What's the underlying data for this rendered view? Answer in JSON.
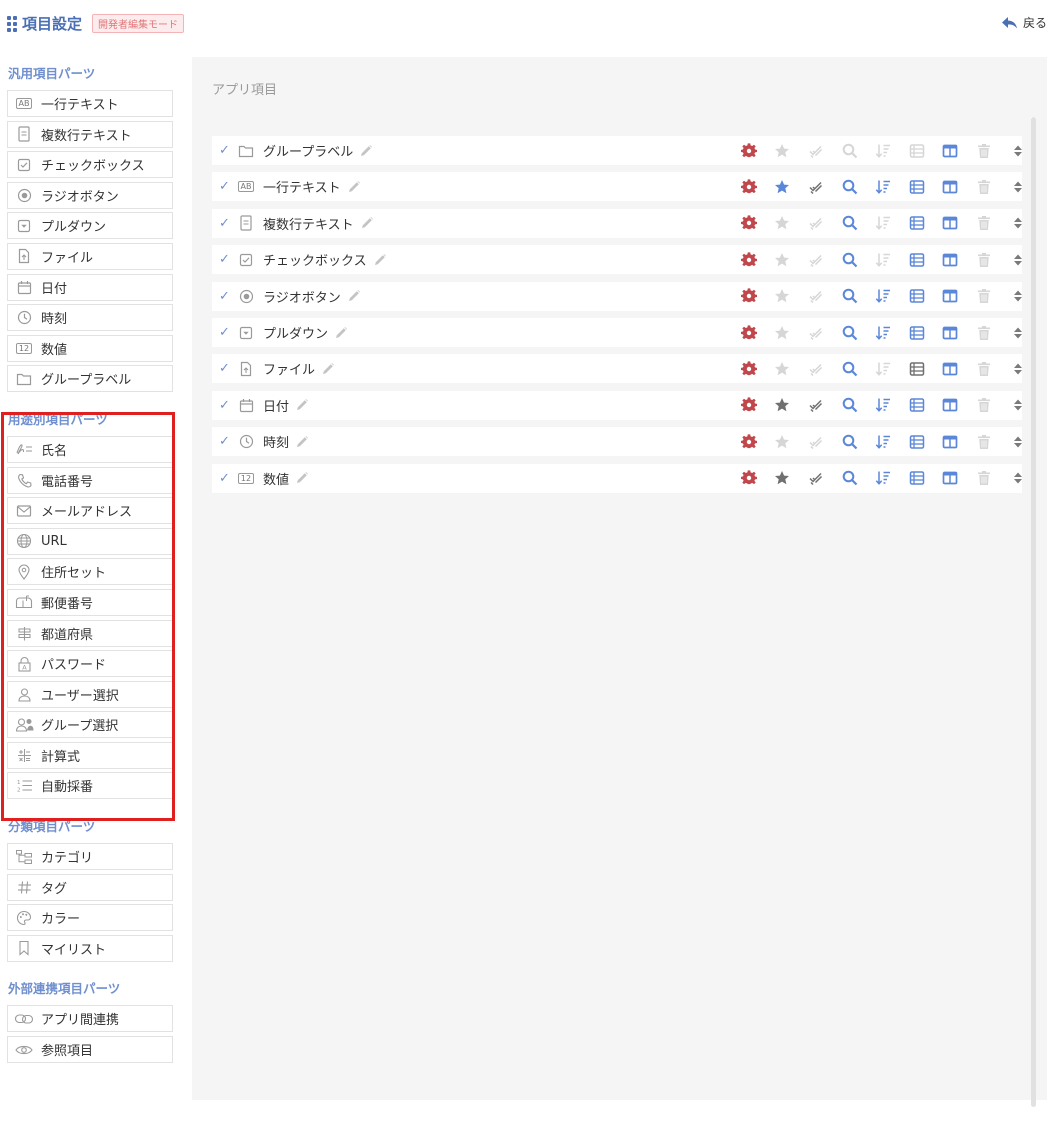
{
  "header": {
    "title": "項目設定",
    "mode_badge": "開発者編集モード",
    "back_label": "戻る"
  },
  "sidebar": {
    "sections": [
      {
        "title": "汎用項目パーツ",
        "items": [
          {
            "label": "一行テキスト",
            "icon": "ab-text-icon"
          },
          {
            "label": "複数行テキスト",
            "icon": "document-icon"
          },
          {
            "label": "チェックボックス",
            "icon": "checkbox-icon"
          },
          {
            "label": "ラジオボタン",
            "icon": "radio-icon"
          },
          {
            "label": "プルダウン",
            "icon": "dropdown-icon"
          },
          {
            "label": "ファイル",
            "icon": "file-upload-icon"
          },
          {
            "label": "日付",
            "icon": "calendar-icon"
          },
          {
            "label": "時刻",
            "icon": "clock-icon"
          },
          {
            "label": "数値",
            "icon": "number-icon"
          },
          {
            "label": "グループラベル",
            "icon": "folder-icon"
          }
        ]
      },
      {
        "title": "用途別項目パーツ",
        "items": [
          {
            "label": "氏名",
            "icon": "name-icon"
          },
          {
            "label": "電話番号",
            "icon": "phone-icon"
          },
          {
            "label": "メールアドレス",
            "icon": "mail-icon"
          },
          {
            "label": "URL",
            "icon": "globe-icon"
          },
          {
            "label": "住所セット",
            "icon": "location-pin-icon"
          },
          {
            "label": "郵便番号",
            "icon": "mailbox-icon"
          },
          {
            "label": "都道府県",
            "icon": "signpost-icon"
          },
          {
            "label": "パスワード",
            "icon": "lock-icon"
          },
          {
            "label": "ユーザー選択",
            "icon": "user-icon"
          },
          {
            "label": "グループ選択",
            "icon": "group-icon"
          },
          {
            "label": "計算式",
            "icon": "calculator-icon"
          },
          {
            "label": "自動採番",
            "icon": "numbered-list-icon"
          }
        ]
      },
      {
        "title": "分類項目パーツ",
        "items": [
          {
            "label": "カテゴリ",
            "icon": "category-tree-icon"
          },
          {
            "label": "タグ",
            "icon": "hashtag-icon"
          },
          {
            "label": "カラー",
            "icon": "palette-icon"
          },
          {
            "label": "マイリスト",
            "icon": "bookmark-icon"
          }
        ]
      },
      {
        "title": "外部連携項目パーツ",
        "items": [
          {
            "label": "アプリ間連携",
            "icon": "link-icon"
          },
          {
            "label": "参照項目",
            "icon": "eye-icon"
          }
        ]
      }
    ]
  },
  "main": {
    "title": "アプリ項目",
    "rows": [
      {
        "label": "グループラベル",
        "icon": "folder-icon",
        "star": "off",
        "check": "off",
        "search": "off",
        "sort": "off",
        "list": "off"
      },
      {
        "label": "一行テキスト",
        "icon": "ab-text-icon",
        "star": "blue",
        "check": "on",
        "search": "on",
        "sort": "on",
        "list": "on"
      },
      {
        "label": "複数行テキスト",
        "icon": "document-icon",
        "star": "off",
        "check": "off",
        "search": "on",
        "sort": "off",
        "list": "on"
      },
      {
        "label": "チェックボックス",
        "icon": "checkbox-icon",
        "star": "off",
        "check": "off",
        "search": "on",
        "sort": "off",
        "list": "on"
      },
      {
        "label": "ラジオボタン",
        "icon": "radio-icon",
        "star": "off",
        "check": "off",
        "search": "on",
        "sort": "on",
        "list": "on"
      },
      {
        "label": "プルダウン",
        "icon": "dropdown-icon",
        "star": "off",
        "check": "off",
        "search": "on",
        "sort": "on",
        "list": "on"
      },
      {
        "label": "ファイル",
        "icon": "file-upload-icon",
        "star": "off",
        "check": "off",
        "search": "on",
        "sort": "off",
        "list": "dark"
      },
      {
        "label": "日付",
        "icon": "calendar-icon",
        "star": "dark",
        "check": "on",
        "search": "on",
        "sort": "on",
        "list": "on"
      },
      {
        "label": "時刻",
        "icon": "clock-icon",
        "star": "off",
        "check": "off",
        "search": "on",
        "sort": "on",
        "list": "on"
      },
      {
        "label": "数値",
        "icon": "number-icon",
        "star": "dark",
        "check": "on",
        "search": "on",
        "sort": "on",
        "list": "on"
      }
    ]
  },
  "colors": {
    "accent": "#4a6fb5",
    "section_title": "#6f8fcf",
    "gear": "#c0474b",
    "highlight_border": "#e01f1f",
    "star_active": "#5b87d9",
    "icon_active": "#5b87d9",
    "icon_inactive": "#d6d6d6",
    "icon_dark": "#707070"
  }
}
